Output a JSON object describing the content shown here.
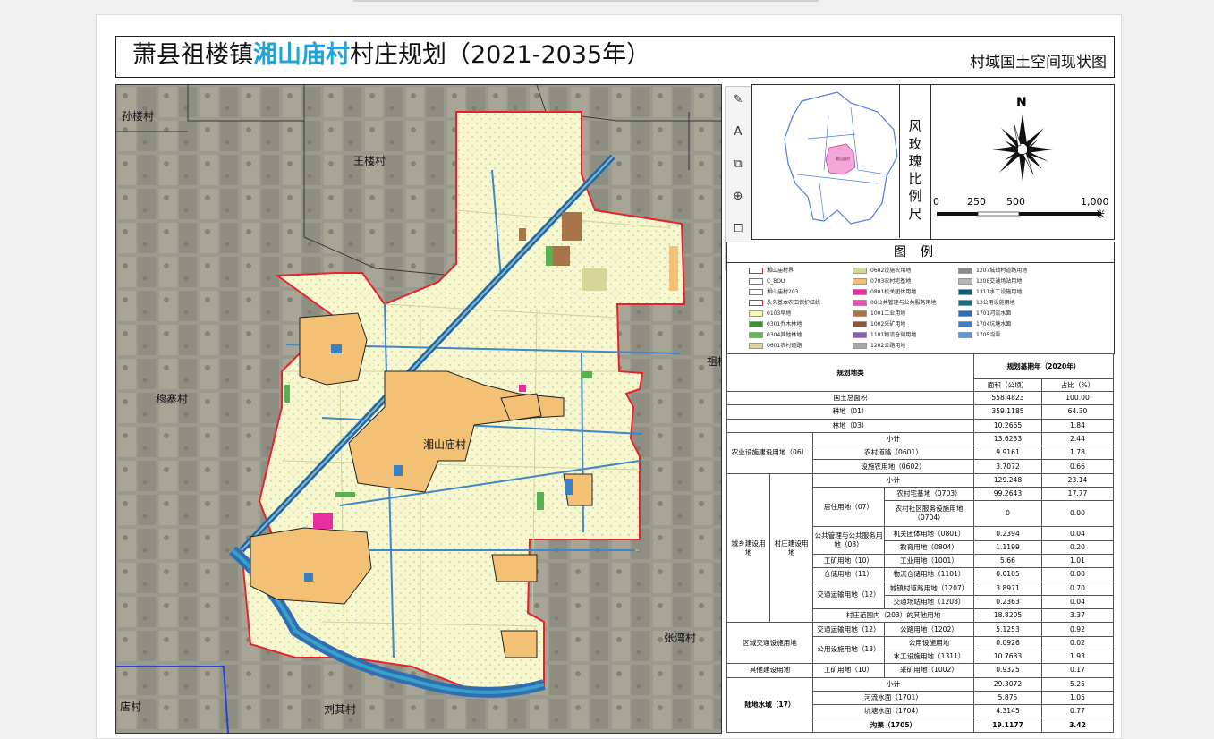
{
  "title": {
    "prefix": "萧县祖楼镇",
    "highlight": "湘山庙村",
    "suffix": "村庄规划（2021-2035年）",
    "highlight_color": "#1fa3d8",
    "map_name": "村域国土空间现状图"
  },
  "map": {
    "village_labels": [
      "孙楼村",
      "王楼村",
      "穆寨村",
      "湘山庙村",
      "祖楼",
      "张湾村",
      "店村",
      "刘其村"
    ],
    "colors": {
      "boundary": "#e8222a",
      "farmland": "#f6f6cc",
      "residential": "#f2c176",
      "water": "#2f7fbf",
      "green": "#57b052",
      "road": "#1b1b1b"
    }
  },
  "toolbar": {
    "icons": [
      "edit-image-icon",
      "draw-text-icon",
      "select-area-icon",
      "zoom-icon",
      "crop-icon"
    ],
    "more_label": "···"
  },
  "locator": {
    "highlight_label": "湘山庙村"
  },
  "compass": {
    "vertical_title": "风玫瑰比例尺",
    "north_label": "N",
    "scale_ticks": [
      "0",
      "250",
      "500",
      "1,000"
    ],
    "scale_unit": "米"
  },
  "legend": {
    "title": "图例",
    "items": [
      {
        "label": "湘山庙村界",
        "color": "#ffffff",
        "border": "#e8222a"
      },
      {
        "label": "C_BOU",
        "color": "#ffffff",
        "border": "#6d6dc8"
      },
      {
        "label": "湘山庙村203",
        "color": "#ffffff",
        "border": "#777777"
      },
      {
        "label": "永久基本农田保护红线",
        "color": "#ffffff",
        "border": "#e8222a"
      },
      {
        "label": "0103旱地",
        "color": "#f6f6b0",
        "border": "#999999"
      },
      {
        "label": "0301乔木林地",
        "color": "#3d8f3a",
        "border": "#999999"
      },
      {
        "label": "0304其他林地",
        "color": "#63b85a",
        "border": "#999999"
      },
      {
        "label": "0601农村道路",
        "color": "#d9d2a0",
        "border": "#999999"
      },
      {
        "label": "0602设施农用地",
        "color": "#d6d59a",
        "border": "#999999"
      },
      {
        "label": "0703农村宅基地",
        "color": "#f2c176",
        "border": "#999999"
      },
      {
        "label": "0801机关团体用地",
        "color": "#e62ea2",
        "border": "#999999"
      },
      {
        "label": "08公共管理与公共服务用地",
        "color": "#e84fb0",
        "border": "#999999"
      },
      {
        "label": "1001工业用地",
        "color": "#a8754b",
        "border": "#999999"
      },
      {
        "label": "1002采矿用地",
        "color": "#8a5a3c",
        "border": "#999999"
      },
      {
        "label": "1101物流仓储用地",
        "color": "#8a5cb8",
        "border": "#999999"
      },
      {
        "label": "1202公路用地",
        "color": "#a8a8a8",
        "border": "#999999"
      },
      {
        "label": "1207城镇村道路用地",
        "color": "#8c8c8c",
        "border": "#999999"
      },
      {
        "label": "1208交通场站用地",
        "color": "#b5b5b5",
        "border": "#999999"
      },
      {
        "label": "1311水工设施用地",
        "color": "#0d5d72",
        "border": "#999999"
      },
      {
        "label": "13公用设施用地",
        "color": "#1a6d80",
        "border": "#999999"
      },
      {
        "label": "1701河流水面",
        "color": "#2e6fb3",
        "border": "#999999"
      },
      {
        "label": "1704坑塘水面",
        "color": "#3a7fc2",
        "border": "#999999"
      },
      {
        "label": "1705沟渠",
        "color": "#5b9ad0",
        "border": "#999999"
      }
    ]
  },
  "stats": {
    "col_type": "规划地类",
    "col_base": "规划基期年（2020年）",
    "col_area": "面积（公顷）",
    "col_pct": "占比（%）",
    "r_total": {
      "name": "国土总面积",
      "area": "558.4823",
      "pct": "100.00"
    },
    "r_farm": {
      "name": "耕地（01）",
      "area": "359.1185",
      "pct": "64.30"
    },
    "r_forest": {
      "name": "林地（03）",
      "area": "10.2665",
      "pct": "1.84"
    },
    "ag": {
      "group": "农业设施建设用地（06）",
      "sub_name": "小计",
      "sub_area": "13.6233",
      "sub_pct": "2.44",
      "rows": [
        {
          "name": "农村道路（0601）",
          "area": "9.9161",
          "pct": "1.78"
        },
        {
          "name": "设施农用地（0602）",
          "area": "3.7072",
          "pct": "0.66"
        }
      ]
    },
    "urban": {
      "group": "城乡建设用地",
      "group2": "村庄建设用地",
      "sub_name": "小计",
      "sub_area": "129.248",
      "sub_pct": "23.14",
      "res": {
        "name": "居住用地（07）",
        "rows": [
          {
            "name": "农村宅基地（0703）",
            "area": "99.2643",
            "pct": "17.77"
          },
          {
            "name": "农村社区服务设施用地（0704）",
            "area": "0",
            "pct": "0.00"
          }
        ]
      },
      "pub": {
        "name": "公共管理与公共服务用地（08）",
        "rows": [
          {
            "name": "机关团体用地（0801）",
            "area": "0.2394",
            "pct": "0.04"
          },
          {
            "name": "教育用地（0804）",
            "area": "1.1199",
            "pct": "0.20"
          }
        ]
      },
      "ind": {
        "name": "工矿用地（10）",
        "row": {
          "name": "工业用地（1001）",
          "area": "5.66",
          "pct": "1.01"
        }
      },
      "store": {
        "name": "仓储用地（11）",
        "row": {
          "name": "物流仓储用地（1101）",
          "area": "0.0105",
          "pct": "0.00"
        }
      },
      "traffic": {
        "name": "交通运输用地（12）",
        "rows": [
          {
            "name": "城镇村道路用地（1207）",
            "area": "3.8971",
            "pct": "0.70"
          },
          {
            "name": "交通场站用地（1208）",
            "area": "0.2363",
            "pct": "0.04"
          }
        ]
      },
      "other": {
        "name": "村庄范围内（203）的其他用地",
        "area": "18.8205",
        "pct": "3.37"
      }
    },
    "region": {
      "group": "区域交通设施用地",
      "traffic": {
        "name": "交通运输用地（12）",
        "row": {
          "name": "公路用地（1202）",
          "area": "5.1253",
          "pct": "0.92"
        }
      },
      "public": {
        "name": "公用设施用地（13）",
        "rows": [
          {
            "name": "公用设施用地",
            "area": "0.0926",
            "pct": "0.02"
          },
          {
            "name": "水工设施用地（1311）",
            "area": "10.7683",
            "pct": "1.93"
          }
        ]
      }
    },
    "otherbuild": {
      "group": "其他建设用地",
      "name": "工矿用地（10）",
      "row": {
        "name": "采矿用地（1002）",
        "area": "0.9325",
        "pct": "0.17"
      }
    },
    "water": {
      "group": "陆地水域（17）",
      "sub_name": "小计",
      "sub_area": "29.3072",
      "sub_pct": "5.25",
      "rows": [
        {
          "name": "河流水面（1701）",
          "area": "5.875",
          "pct": "1.05"
        },
        {
          "name": "坑塘水面（1704）",
          "area": "4.3145",
          "pct": "0.77"
        },
        {
          "name": "沟渠（1705）",
          "area": "19.1177",
          "pct": "3.42"
        }
      ]
    }
  }
}
